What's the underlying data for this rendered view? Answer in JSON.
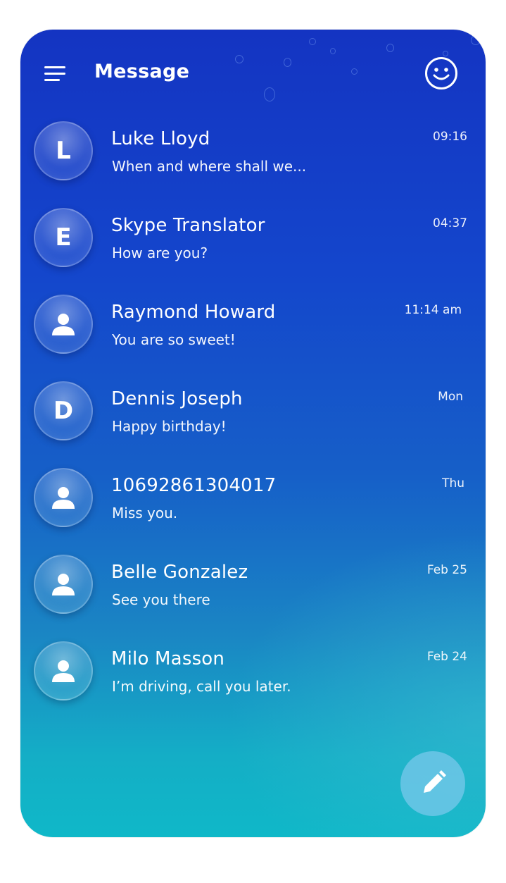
{
  "header": {
    "title": "Message",
    "menu_icon": "hamburger-menu-icon",
    "action_icon": "smiley-face-icon"
  },
  "conversations": [
    {
      "avatar_type": "letter",
      "initial": "L",
      "name": "Luke Lloyd",
      "preview": "When and where shall we...",
      "time": "09:16"
    },
    {
      "avatar_type": "letter",
      "initial": "E",
      "name": "Skype Translator",
      "preview": "How are you?",
      "time": "04:37"
    },
    {
      "avatar_type": "person",
      "initial": "",
      "name": "Raymond Howard",
      "preview": "You are so sweet!",
      "time": "11:14 am"
    },
    {
      "avatar_type": "letter",
      "initial": "D",
      "name": "Dennis Joseph",
      "preview": "Happy birthday!",
      "time": "Mon"
    },
    {
      "avatar_type": "person",
      "initial": "",
      "name": "10692861304017",
      "preview": "Miss you.",
      "time": "Thu"
    },
    {
      "avatar_type": "person",
      "initial": "",
      "name": "Belle Gonzalez",
      "preview": "See you there",
      "time": "Feb 25"
    },
    {
      "avatar_type": "person",
      "initial": "",
      "name": "Milo Masson",
      "preview": "I’m driving, call you later.",
      "time": "Feb 24"
    }
  ],
  "fab": {
    "icon": "pencil-compose-icon"
  },
  "colors": {
    "background_top": "#1434c2",
    "background_bottom": "#0fb8c8",
    "text": "#ffffff"
  }
}
